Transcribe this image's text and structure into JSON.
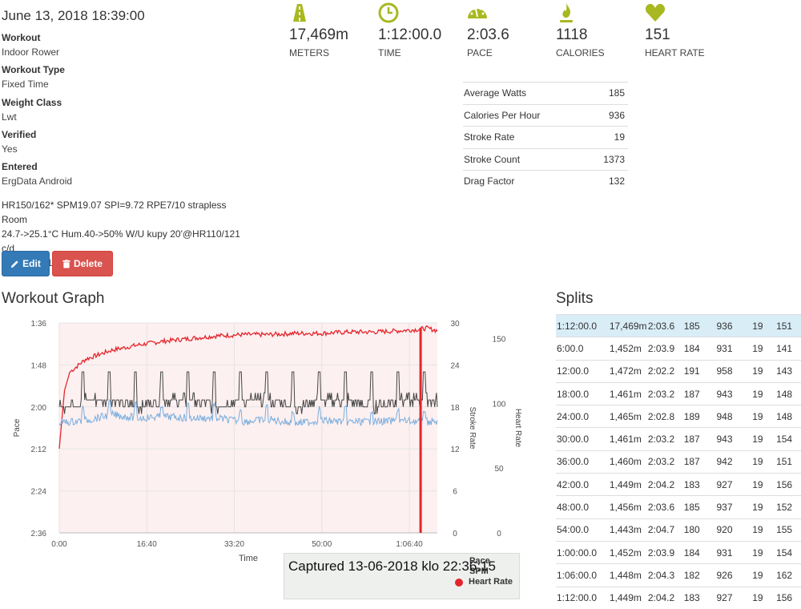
{
  "workout": {
    "date_title": "June 13, 2018 18:39:00",
    "fields": [
      {
        "label": "Workout",
        "value": "Indoor Rower"
      },
      {
        "label": "Workout Type",
        "value": "Fixed Time"
      },
      {
        "label": "Weight Class",
        "value": "Lwt"
      },
      {
        "label": "Verified",
        "value": "Yes"
      },
      {
        "label": "Entered",
        "value": "ErgData Android"
      }
    ],
    "notes_lines": [
      "HR150/162* SPM19.07 SPI=9.72 RPE7/10 strapless Room",
      "24.7->25.1°C Hum.40->50% W/U kupy 20'@HR110/121 c/d",
      "10'@HR111/120"
    ],
    "edit_label": "Edit",
    "delete_label": "Delete"
  },
  "stats": [
    {
      "icon": "road-icon",
      "value": "17,469m",
      "label": "METERS"
    },
    {
      "icon": "clock-icon",
      "value": "1:12:00.0",
      "label": "TIME"
    },
    {
      "icon": "speedometer-icon",
      "value": "2:03.6",
      "label": "PACE"
    },
    {
      "icon": "flame-icon",
      "value": "1118",
      "label": "CALORIES"
    },
    {
      "icon": "heart-icon",
      "value": "151",
      "label": "HEART RATE"
    }
  ],
  "accent_color": "#a8b820",
  "metrics": [
    {
      "label": "Average Watts",
      "value": "185"
    },
    {
      "label": "Calories Per Hour",
      "value": "936"
    },
    {
      "label": "Stroke Rate",
      "value": "19"
    },
    {
      "label": "Stroke Count",
      "value": "1373"
    },
    {
      "label": "Drag Factor",
      "value": "132"
    }
  ],
  "graph": {
    "title": "Workout Graph",
    "captured_text": "Captured 13-06-2018 klo 22:36:15",
    "legend_pace": "Pace",
    "legend_spm": "SPM",
    "legend_hr": "Heart Rate"
  },
  "chart_data": {
    "type": "line",
    "xlabel": "Time",
    "y_left_label": "Pace",
    "y_mid_label": "Stroke Rate",
    "y_right_label": "Heart Rate",
    "x_ticks": [
      "0:00",
      "16:40",
      "33:20",
      "50:00",
      "1:06:40"
    ],
    "pace_ticks": [
      "1:36",
      "1:48",
      "2:00",
      "2:12",
      "2:24",
      "2:36"
    ],
    "spm_ticks": [
      "30",
      "24",
      "18",
      "12",
      "6",
      "0"
    ],
    "hr_ticks": [
      "150",
      "100",
      "50",
      "0"
    ],
    "xlim_seconds": [
      0,
      4320
    ],
    "pace_lim_seconds": [
      96,
      156
    ],
    "spm_lim": [
      0,
      30
    ],
    "hr_lim": [
      0,
      162
    ],
    "colors": {
      "pace": "#7aaede",
      "spm": "#444444",
      "hr": "#e3262d",
      "fill": "#fdf0f0"
    },
    "series": [
      {
        "name": "Heart Rate",
        "x": [
          0,
          60,
          120,
          300,
          600,
          900,
          1200,
          1500,
          1800,
          2100,
          2400,
          2700,
          3000,
          3300,
          3600,
          3900,
          4100,
          4200,
          4320
        ],
        "values": [
          65,
          110,
          124,
          134,
          141,
          145,
          148,
          150,
          152,
          153,
          153,
          154,
          154,
          155,
          155,
          156,
          157,
          158,
          156
        ]
      },
      {
        "name": "SPM",
        "x": [
          0,
          300,
          600,
          900,
          1200,
          1500,
          1800,
          2100,
          2400,
          2700,
          3000,
          3300,
          3600,
          3900,
          4200,
          4320
        ],
        "values": [
          18,
          19,
          19,
          18,
          19,
          19,
          18,
          19,
          19,
          18,
          19,
          19,
          18,
          19,
          19,
          19
        ]
      },
      {
        "name": "Pace",
        "x": [
          0,
          300,
          600,
          900,
          1200,
          1500,
          1800,
          2100,
          2400,
          2700,
          3000,
          3300,
          3600,
          3900,
          4200,
          4320
        ],
        "values": [
          124.5,
          123.9,
          122.2,
          123.2,
          122.8,
          123.2,
          123.2,
          124.2,
          123.6,
          124.7,
          123.9,
          124.3,
          124.2,
          124.0,
          124.2,
          124.2
        ]
      }
    ]
  },
  "splits": {
    "title": "Splits",
    "rows": [
      [
        "1:12:00.0",
        "17,469m",
        "2:03.6",
        "185",
        "936",
        "19",
        "151"
      ],
      [
        "6:00.0",
        "1,452m",
        "2:03.9",
        "184",
        "931",
        "19",
        "141"
      ],
      [
        "12:00.0",
        "1,472m",
        "2:02.2",
        "191",
        "958",
        "19",
        "143"
      ],
      [
        "18:00.0",
        "1,461m",
        "2:03.2",
        "187",
        "943",
        "19",
        "148"
      ],
      [
        "24:00.0",
        "1,465m",
        "2:02.8",
        "189",
        "948",
        "19",
        "148"
      ],
      [
        "30:00.0",
        "1,461m",
        "2:03.2",
        "187",
        "943",
        "19",
        "154"
      ],
      [
        "36:00.0",
        "1,460m",
        "2:03.2",
        "187",
        "942",
        "19",
        "151"
      ],
      [
        "42:00.0",
        "1,449m",
        "2:04.2",
        "183",
        "927",
        "19",
        "156"
      ],
      [
        "48:00.0",
        "1,456m",
        "2:03.6",
        "185",
        "937",
        "19",
        "152"
      ],
      [
        "54:00.0",
        "1,443m",
        "2:04.7",
        "180",
        "920",
        "19",
        "155"
      ],
      [
        "1:00:00.0",
        "1,452m",
        "2:03.9",
        "184",
        "931",
        "19",
        "154"
      ],
      [
        "1:06:00.0",
        "1,448m",
        "2:04.3",
        "182",
        "926",
        "19",
        "162"
      ],
      [
        "1:12:00.0",
        "1,449m",
        "2:04.2",
        "183",
        "927",
        "19",
        "156"
      ]
    ]
  }
}
